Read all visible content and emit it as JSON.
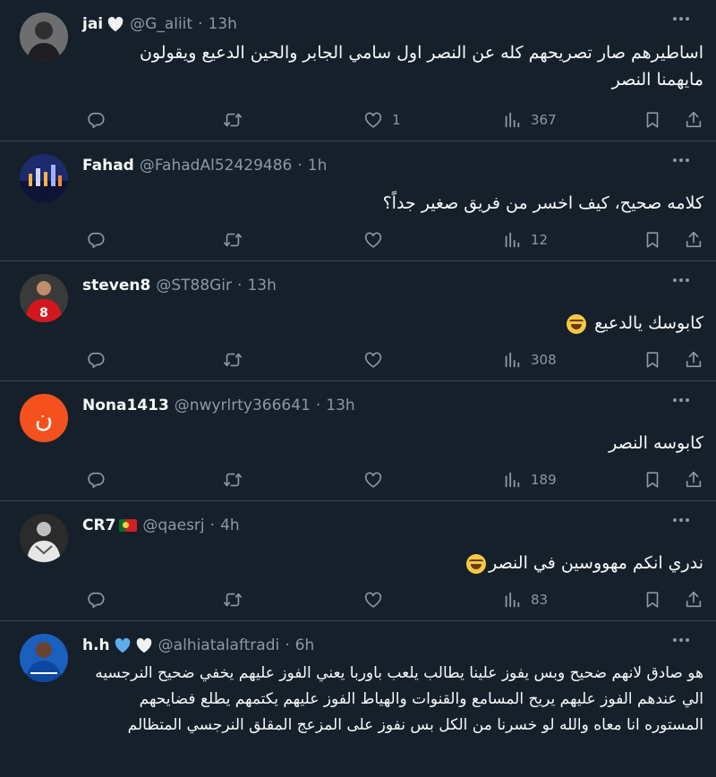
{
  "icons": {
    "reply": "reply-icon",
    "retweet": "retweet-icon",
    "like": "heart-icon",
    "views": "views-icon",
    "bookmark": "bookmark-icon",
    "share": "share-icon",
    "more": "more-icon"
  },
  "colors": {
    "background": "#15202b",
    "divider": "#38444d",
    "muted": "#8b98a5",
    "text": "#f7f9f9"
  },
  "tweets": [
    {
      "username": "jai",
      "handle": "@G_aliit",
      "sep": "·",
      "time": "13h",
      "text": "اساطيرهم صار تصريحهم كله عن النصر اول سامي الجابر والحين الدعيع ويقولون مايهمنا النصر",
      "likes": "1",
      "views": "367"
    },
    {
      "username": "Fahad",
      "handle": "@FahadAl52429486",
      "sep": "·",
      "time": "1h",
      "text": "كلامه صحيح، كيف اخسر من فريق صغير جداً؟",
      "likes": "",
      "views": "12"
    },
    {
      "username": "steven8",
      "handle": "@ST88Gir",
      "sep": "·",
      "time": "13h",
      "text": "كابوسك يالدعيع",
      "likes": "",
      "views": "308"
    },
    {
      "username": "Nona1413",
      "handle": "@nwyrlrty366641",
      "sep": "·",
      "time": "13h",
      "text": "كابوسه النصر",
      "likes": "",
      "views": "189",
      "avatar_letter": "ن"
    },
    {
      "username": "CR7",
      "handle": "@qaesrj",
      "sep": "·",
      "time": "4h",
      "text": "ندري انكم مهووسين في النصر",
      "likes": "",
      "views": "83"
    },
    {
      "username": "h.h",
      "handle": "@alhiatalaftradi",
      "sep": "·",
      "time": "6h",
      "text": "هو صادق لانهم ضحيح وبس يفوز علينا يطالب يلعب باوربا يعني الفوز عليهم يخفي ضحيح النرجسيه الي عندهم الفوز عليهم يريح المسامع والقنوات والهياط الفوز عليهم يكتمهم يطلع فضايحهم المستوره انا معاه والله لو خسرنا من الكل بس نفوز على المزعج المقلق النرجسي المتظالم"
    }
  ]
}
